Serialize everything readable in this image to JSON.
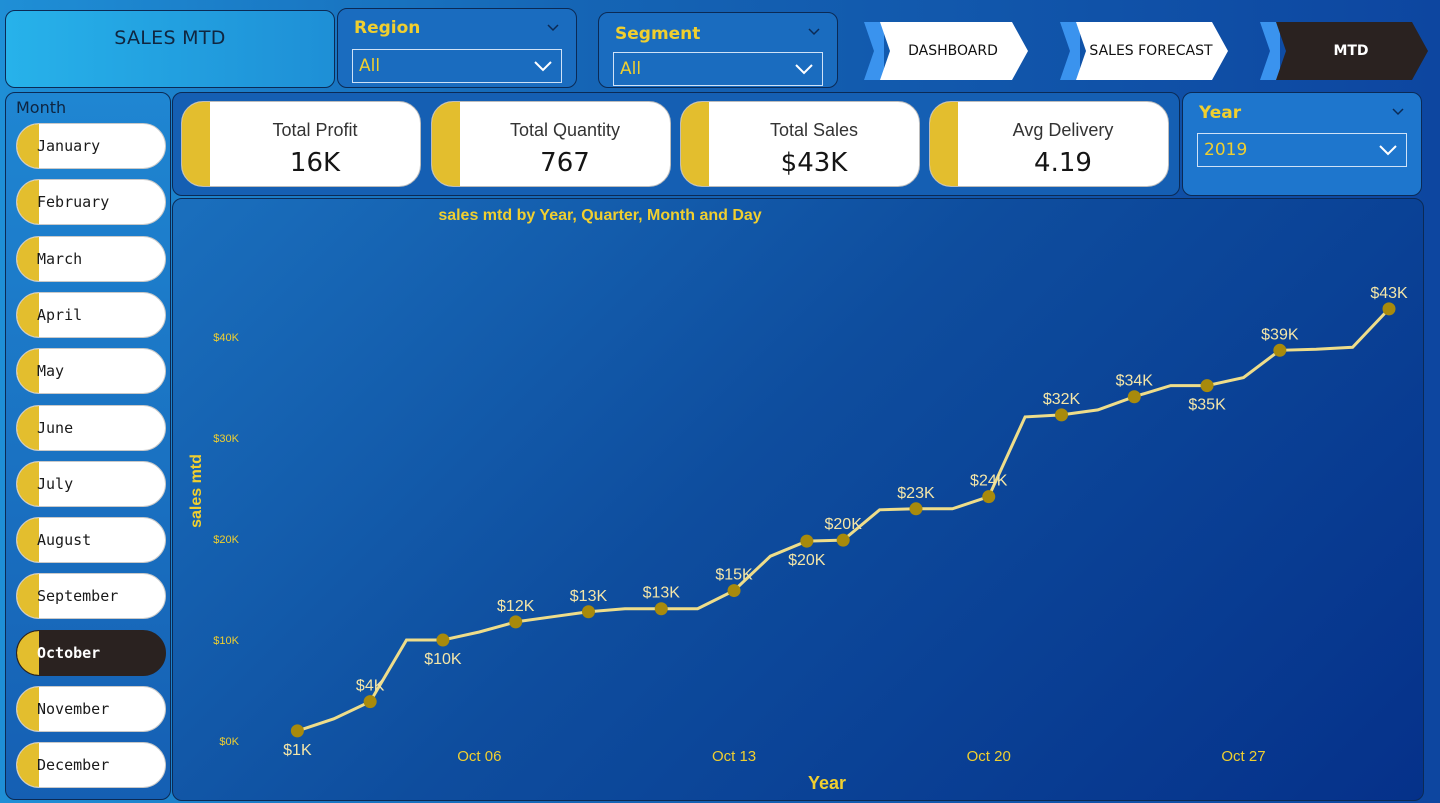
{
  "title": "SALES MTD",
  "region": {
    "label": "Region",
    "value": "All"
  },
  "segment": {
    "label": "Segment",
    "value": "All"
  },
  "nav": {
    "dashboard": "DASHBOARD",
    "forecast": "SALES FORECAST",
    "mtd": "MTD"
  },
  "month_slicer": {
    "header": "Month",
    "months": [
      "January",
      "February",
      "March",
      "April",
      "May",
      "June",
      "July",
      "August",
      "September",
      "October",
      "November",
      "December"
    ],
    "selected": "October"
  },
  "kpis": {
    "profit": {
      "label": "Total Profit",
      "value": "16K"
    },
    "quantity": {
      "label": "Total Quantity",
      "value": "767"
    },
    "sales": {
      "label": "Total Sales",
      "value": "$43K"
    },
    "delivery": {
      "label": "Avg Delivery",
      "value": "4.19"
    }
  },
  "year": {
    "label": "Year",
    "value": "2019"
  },
  "colors": {
    "accent": "#f0cf2f",
    "line": "#eedd8a",
    "marker": "#a88a0c",
    "selected": "#2a2220",
    "cap": "#e3be2e"
  },
  "chart_data": {
    "type": "line",
    "title": "sales mtd by Year, Quarter, Month and Day",
    "xlabel": "Year",
    "ylabel": "sales mtd",
    "ylim": [
      0,
      45000
    ],
    "yticks": [
      0,
      10000,
      20000,
      30000,
      40000
    ],
    "ytick_labels": [
      "$0K",
      "$10K",
      "$20K",
      "$30K",
      "$40K"
    ],
    "xtick_labels": [
      {
        "x": "2019-10-06",
        "label": "Oct 06"
      },
      {
        "x": "2019-10-13",
        "label": "Oct 13"
      },
      {
        "x": "2019-10-20",
        "label": "Oct 20"
      },
      {
        "x": "2019-10-27",
        "label": "Oct 27"
      }
    ],
    "x_range": [
      "2019-09-30",
      "2019-10-31"
    ],
    "series": [
      {
        "points": [
          {
            "x": "2019-10-01",
            "y": 1000
          },
          {
            "x": "2019-10-02",
            "y": 2200
          },
          {
            "x": "2019-10-03",
            "y": 3900
          },
          {
            "x": "2019-10-04",
            "y": 10000
          },
          {
            "x": "2019-10-05",
            "y": 10000
          },
          {
            "x": "2019-10-06",
            "y": 10800
          },
          {
            "x": "2019-10-07",
            "y": 11800
          },
          {
            "x": "2019-10-08",
            "y": 12300
          },
          {
            "x": "2019-10-09",
            "y": 12800
          },
          {
            "x": "2019-10-10",
            "y": 13100
          },
          {
            "x": "2019-10-11",
            "y": 13100
          },
          {
            "x": "2019-10-12",
            "y": 13100
          },
          {
            "x": "2019-10-13",
            "y": 14900
          },
          {
            "x": "2019-10-14",
            "y": 18300
          },
          {
            "x": "2019-10-15",
            "y": 19800
          },
          {
            "x": "2019-10-16",
            "y": 19900
          },
          {
            "x": "2019-10-17",
            "y": 22900
          },
          {
            "x": "2019-10-18",
            "y": 23000
          },
          {
            "x": "2019-10-19",
            "y": 23000
          },
          {
            "x": "2019-10-20",
            "y": 24200
          },
          {
            "x": "2019-10-21",
            "y": 32100
          },
          {
            "x": "2019-10-22",
            "y": 32300
          },
          {
            "x": "2019-10-23",
            "y": 32800
          },
          {
            "x": "2019-10-24",
            "y": 34100
          },
          {
            "x": "2019-10-25",
            "y": 35200
          },
          {
            "x": "2019-10-26",
            "y": 35200
          },
          {
            "x": "2019-10-27",
            "y": 36000
          },
          {
            "x": "2019-10-28",
            "y": 38700
          },
          {
            "x": "2019-10-29",
            "y": 38800
          },
          {
            "x": "2019-10-30",
            "y": 39000
          },
          {
            "x": "2019-10-31",
            "y": 42800
          }
        ]
      }
    ],
    "markers": [
      {
        "x": "2019-10-01",
        "label": "$1K",
        "pos": "below"
      },
      {
        "x": "2019-10-03",
        "label": "$4K",
        "pos": "above"
      },
      {
        "x": "2019-10-05",
        "label": "$10K",
        "pos": "below"
      },
      {
        "x": "2019-10-07",
        "label": "$12K",
        "pos": "above"
      },
      {
        "x": "2019-10-09",
        "label": "$13K",
        "pos": "above"
      },
      {
        "x": "2019-10-11",
        "label": "$13K",
        "pos": "above"
      },
      {
        "x": "2019-10-13",
        "label": "$15K",
        "pos": "above"
      },
      {
        "x": "2019-10-15",
        "label": "$20K",
        "pos": "below"
      },
      {
        "x": "2019-10-16",
        "label": "$20K",
        "pos": "above"
      },
      {
        "x": "2019-10-18",
        "label": "$23K",
        "pos": "above"
      },
      {
        "x": "2019-10-20",
        "label": "$24K",
        "pos": "above"
      },
      {
        "x": "2019-10-22",
        "label": "$32K",
        "pos": "above"
      },
      {
        "x": "2019-10-24",
        "label": "$34K",
        "pos": "above"
      },
      {
        "x": "2019-10-26",
        "label": "$35K",
        "pos": "below"
      },
      {
        "x": "2019-10-28",
        "label": "$39K",
        "pos": "above"
      },
      {
        "x": "2019-10-31",
        "label": "$43K",
        "pos": "above"
      }
    ]
  }
}
